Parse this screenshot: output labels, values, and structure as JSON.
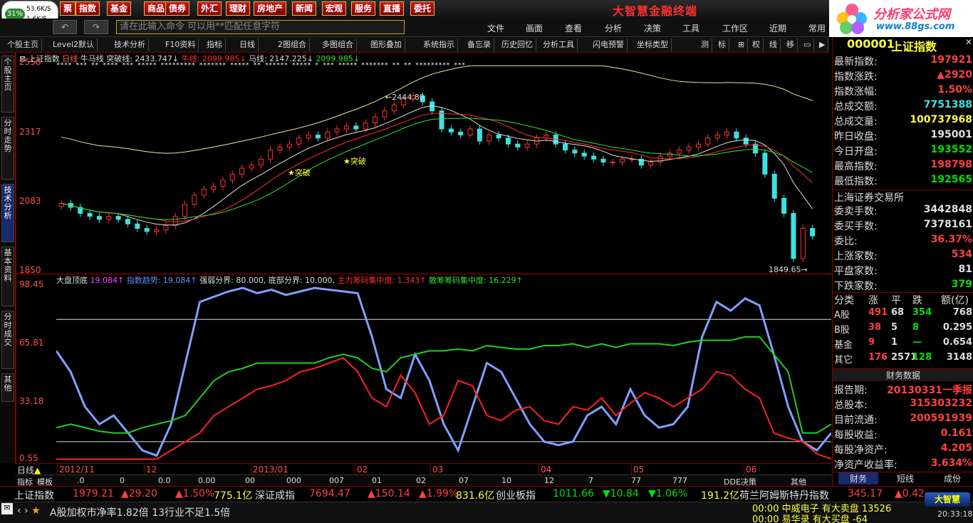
{
  "speed": {
    "pct": "31%",
    "up": "53.6K/S",
    "down": "1.6K/S"
  },
  "menubar": [
    "指数",
    "基金",
    "商品",
    "债券",
    "外汇",
    "理财",
    "房地产",
    "新闻",
    "宏观",
    "服务",
    "直播",
    "委托"
  ],
  "app_title": "大智慧金融终端",
  "logo": {
    "title": "分析家公式网",
    "url": "www.88gs.com"
  },
  "cmd_placeholder": "请在此输入命令   可以用**匹配任意字符",
  "top_menus": [
    "文件",
    "画面",
    "查看",
    "分析",
    "决策",
    "工具",
    "工作区",
    "近期",
    "常用"
  ],
  "toolbar": [
    "个股主页",
    "Level2默认",
    "技术分析",
    "F10资料",
    "指标",
    "日线",
    "2图组合",
    "多图组合",
    "图形叠加",
    "系统指示",
    "备忘录",
    "历史回忆",
    "分析工具",
    "闪电预警",
    "坐标类型",
    "测",
    "标",
    "⊞",
    "权",
    "线",
    "移"
  ],
  "left_tabs": [
    "个股主页",
    "分时走势",
    "技术分析",
    "基本资料",
    "分时成交",
    "其他"
  ],
  "main_chart": {
    "header": {
      "name": "上证指数",
      "period": "日线",
      "ind": "牛马线",
      "tp": "突破线: 2433.747↓",
      "niu": "牛线: 2099.985↓",
      "ma": "马线: 2147.225↓",
      "v4": "2099.985↓"
    },
    "y_ticks": [
      "2550",
      "2317",
      "2083",
      "1850"
    ],
    "annotations": {
      "hi": "2444.80",
      "lo": "1849.65",
      "break1": "★突破",
      "break2": "★突破"
    }
  },
  "sub_chart": {
    "header": {
      "name": "大盘顶底",
      "a": "19.084↑",
      "b": "指数趋势: 19.084↑",
      "c": "强弱分界: 80.000,",
      "d": "底部分界: 10.000,",
      "e": "主力筹码集中度: 1.343↑",
      "f": "散筹筹码集中度: 16.229↑"
    },
    "y_ticks": [
      "98.45",
      "65.81",
      "33.18",
      "0.55"
    ]
  },
  "chart_data": {
    "type": "line",
    "series": [
      {
        "name": "指数趋势",
        "values": [
          62,
          50,
          30,
          20,
          25,
          15,
          5,
          2,
          20,
          55,
          90,
          93,
          96,
          98,
          95,
          97,
          94,
          96,
          98,
          97,
          96,
          95,
          70,
          40,
          35,
          60,
          45,
          20,
          5,
          30,
          55,
          50,
          35,
          20,
          10,
          8,
          10,
          25,
          30,
          20,
          40,
          25,
          18,
          20,
          30,
          70,
          90,
          85,
          92,
          88,
          60,
          30,
          10,
          5,
          15
        ]
      },
      {
        "name": "主力筹码集中度",
        "values": [
          0,
          0,
          0,
          0,
          0,
          0,
          0,
          0,
          5,
          10,
          15,
          25,
          30,
          35,
          40,
          42,
          45,
          50,
          52,
          55,
          58,
          50,
          35,
          30,
          48,
          38,
          20,
          25,
          45,
          42,
          25,
          22,
          28,
          30,
          22,
          20,
          30,
          28,
          35,
          25,
          32,
          38,
          35,
          30,
          35,
          40,
          50,
          48,
          40,
          35,
          15,
          12,
          10,
          3,
          0
        ]
      },
      {
        "name": "散筹筹码集中度",
        "values": [
          18,
          20,
          18,
          16,
          15,
          15,
          18,
          20,
          22,
          25,
          35,
          45,
          50,
          52,
          55,
          55,
          55,
          55,
          55,
          58,
          60,
          58,
          52,
          50,
          58,
          60,
          62,
          62,
          63,
          62,
          65,
          64,
          63,
          63,
          65,
          65,
          66,
          64,
          66,
          64,
          66,
          66,
          66,
          65,
          67,
          68,
          68,
          68,
          70,
          70,
          60,
          50,
          15,
          15,
          20
        ]
      }
    ],
    "x": [
      "2012/11",
      "12",
      "2013/01",
      "02",
      "03",
      "04",
      "05",
      "06"
    ],
    "ylim": [
      0.55,
      98.45
    ]
  },
  "x_labels": [
    "2012/11",
    "12",
    "2013/01",
    "02",
    "03",
    "04",
    "05",
    "06"
  ],
  "stat_row": [
    "指标",
    "模板",
    ".0",
    "0",
    "0.0",
    "0.00",
    "00",
    "000",
    "007",
    "01",
    "02",
    "07",
    "10",
    "12",
    "7",
    "77",
    "777",
    "DDE决策",
    "其他"
  ],
  "right_panel": {
    "code": "000001",
    "name": "上证指数",
    "rows": [
      [
        "最新指数:",
        "197921",
        "red"
      ],
      [
        "指数涨跌:",
        "▲2920",
        "red"
      ],
      [
        "指数涨幅:",
        "1.50%",
        "red"
      ],
      [
        "总成交额:",
        "7751388",
        "cyan"
      ],
      [
        "总成交量:",
        "100737968",
        "yellow"
      ],
      [
        "昨日收盘:",
        "195001",
        "white"
      ],
      [
        "今日开盘:",
        "193552",
        "green"
      ],
      [
        "最高指数:",
        "198798",
        "red"
      ],
      [
        "最低指数:",
        "192565",
        "green"
      ]
    ],
    "exchange": "上海证券交易所",
    "rows2": [
      [
        "委卖手数:",
        "3442848",
        "white"
      ],
      [
        "委买手数:",
        "7378161",
        "white"
      ],
      [
        "委比:",
        "36.37%",
        "red"
      ],
      [
        "上涨家数:",
        "534",
        "red"
      ],
      [
        "平盘家数:",
        "81",
        "white"
      ],
      [
        "下跌家数:",
        "379",
        "green"
      ]
    ],
    "tbl_head": [
      "分类",
      "涨",
      "平",
      "跌",
      "额(亿)"
    ],
    "tbl": [
      [
        "A股",
        "491",
        "68",
        "354",
        "768"
      ],
      [
        "B股",
        "38",
        "5",
        "8",
        "0.295"
      ],
      [
        "基金",
        "9",
        "1",
        "—",
        "0.654"
      ],
      [
        "其它",
        "176",
        "2571",
        "128",
        "3148"
      ]
    ],
    "fin_title": "财务数据",
    "fin": [
      [
        "报告期:",
        "20130331一季报",
        "red"
      ],
      [
        "总股本:",
        "315303232",
        "red"
      ],
      [
        "目前流通:",
        "200591939",
        "red"
      ],
      [
        "每股收益:",
        "0.161",
        "red"
      ],
      [
        "每股净资产:",
        "4.205",
        "red"
      ],
      [
        "净资产收益率:",
        "3.634%",
        "red"
      ]
    ],
    "tabs": [
      "财务",
      "短线",
      "成份"
    ]
  },
  "ticker": [
    [
      "上证指数",
      "white"
    ],
    [
      "1979.21",
      "red"
    ],
    [
      "▲29.20",
      "red"
    ],
    [
      "▲1.50%",
      "red"
    ],
    [
      "775.1亿",
      "yellow"
    ],
    [
      "深证成指",
      "white"
    ],
    [
      "7694.47",
      "red"
    ],
    [
      "▲150.14",
      "red"
    ],
    [
      "▲1.99%",
      "red"
    ],
    [
      "831.6亿",
      "yellow"
    ],
    [
      "创业板指",
      "white"
    ],
    [
      "1011.66",
      "green"
    ],
    [
      "▼10.84",
      "green"
    ],
    [
      "▼1.06%",
      "green"
    ],
    [
      "191.2亿",
      "yellow"
    ],
    [
      "荷兰阿姆斯特丹指数",
      "white"
    ],
    [
      "345.17",
      "red"
    ],
    [
      "▲0.42",
      "red"
    ]
  ],
  "news": {
    "text": "A股加权市净率1.82倍 13行业不足1.5倍",
    "a": "00:00 中威电子 有大卖盘 13526",
    "b": "00:00 易华录  有大买盘 -64",
    "brand": "大智慧",
    "time": "20:33:18"
  }
}
